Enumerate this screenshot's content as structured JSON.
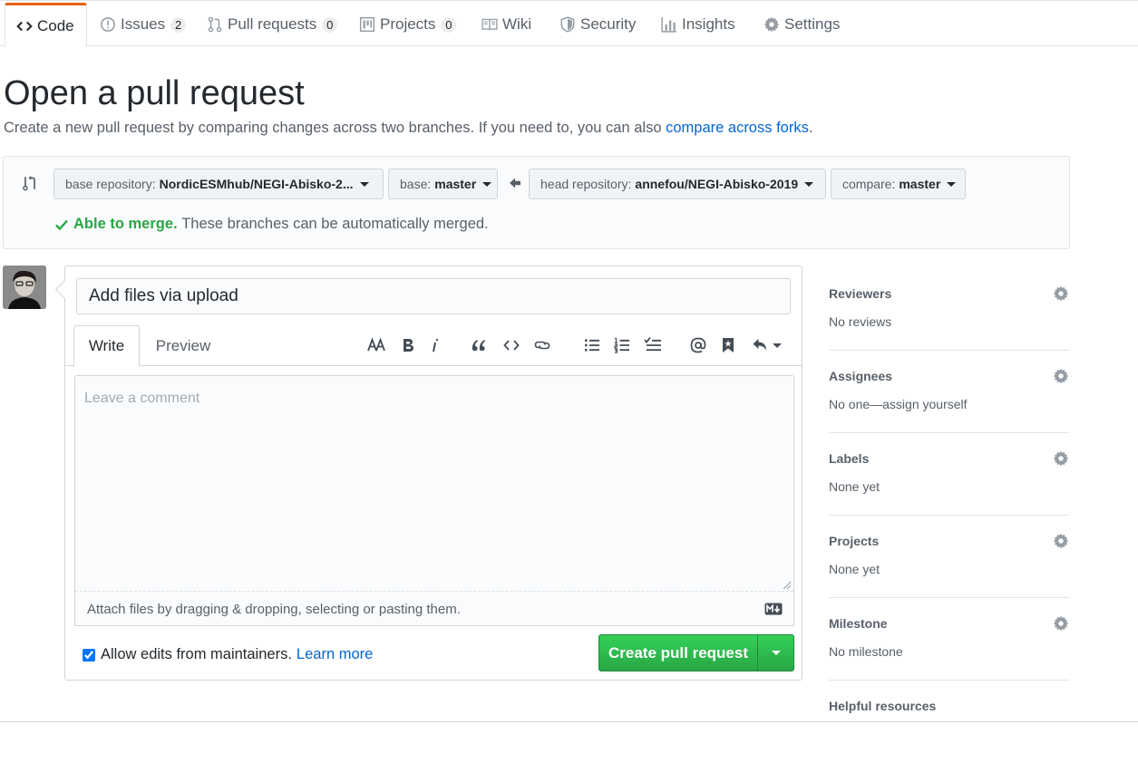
{
  "nav": {
    "tabs": [
      {
        "label": "Code",
        "icon": "code-icon"
      },
      {
        "label": "Issues",
        "count": "2",
        "icon": "issue-icon"
      },
      {
        "label": "Pull requests",
        "count": "0",
        "icon": "pull-request-icon"
      },
      {
        "label": "Projects",
        "count": "0",
        "icon": "project-icon"
      },
      {
        "label": "Wiki",
        "icon": "book-icon"
      },
      {
        "label": "Security",
        "icon": "shield-icon"
      },
      {
        "label": "Insights",
        "icon": "graph-icon"
      },
      {
        "label": "Settings",
        "icon": "gear-icon"
      }
    ]
  },
  "header": {
    "title": "Open a pull request",
    "subtitle": "Create a new pull request by comparing changes across two branches. If you need to, you can also",
    "subtitle_link": "compare across forks",
    "subtitle_end": "."
  },
  "range": {
    "base_repo_key": "base repository:",
    "base_repo_value": "NordicESMhub/NEGI-Abisko-2...",
    "base_key": "base:",
    "base_value": "master",
    "head_repo_key": "head repository:",
    "head_repo_value": "annefou/NEGI-Abisko-2019",
    "compare_key": "compare:",
    "compare_value": "master",
    "merge_ok": "Able to merge.",
    "merge_text": "These branches can be automatically merged."
  },
  "form": {
    "title_value": "Add files via upload",
    "tab_write": "Write",
    "tab_preview": "Preview",
    "comment_placeholder": "Leave a comment",
    "attach_text": "Attach files by dragging & dropping, selecting or pasting them.",
    "allow_edits": "Allow edits from maintainers.",
    "learn_more": "Learn more",
    "submit": "Create pull request"
  },
  "sidebar": {
    "items": [
      {
        "heading": "Reviewers",
        "value": "No reviews"
      },
      {
        "heading": "Assignees",
        "value": "No one—assign yourself"
      },
      {
        "heading": "Labels",
        "value": "None yet"
      },
      {
        "heading": "Projects",
        "value": "None yet"
      },
      {
        "heading": "Milestone",
        "value": "No milestone"
      },
      {
        "heading": "Helpful resources",
        "value": ""
      }
    ]
  },
  "colors": {
    "accent_orange": "#e36209",
    "link_blue": "#0366d6",
    "success_green": "#28a745"
  }
}
